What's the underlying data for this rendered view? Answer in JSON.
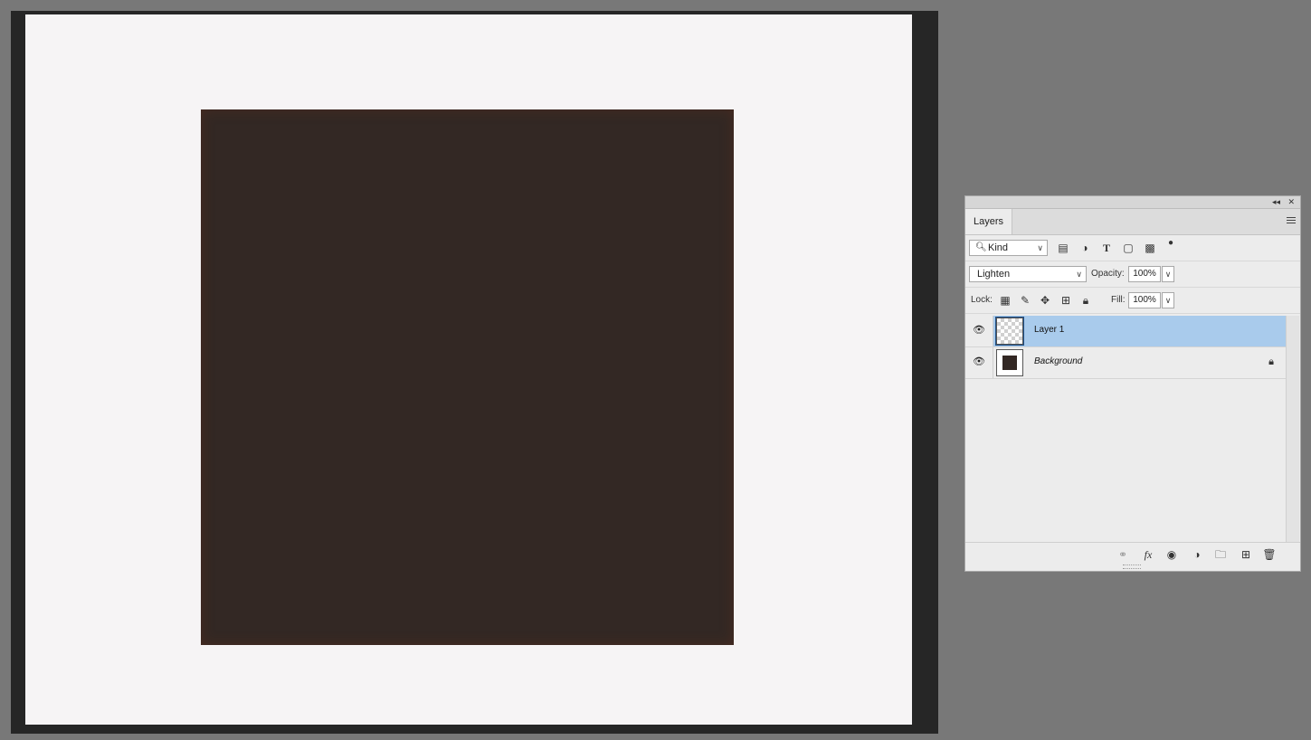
{
  "document": {
    "canvas_color": "#f6f4f5",
    "square_color": "#332824"
  },
  "layers_panel": {
    "tab_label": "Layers",
    "collapse_icon": "double-chevron-left-icon",
    "close_icon": "close-icon",
    "filter": {
      "kind_label": "Kind",
      "icons": [
        "pixel-layer-filter-icon",
        "adjustment-layer-filter-icon",
        "type-layer-filter-icon",
        "shape-layer-filter-icon",
        "smart-object-filter-icon",
        "filter-toggle-icon"
      ]
    },
    "blend_mode": "Lighten",
    "opacity_label": "Opacity:",
    "opacity_value": "100%",
    "lock_label": "Lock:",
    "fill_label": "Fill:",
    "fill_value": "100%",
    "layers": [
      {
        "name": "Layer 1",
        "visible": true,
        "selected": true,
        "locked": false
      },
      {
        "name": "Background",
        "visible": true,
        "selected": false,
        "locked": true
      }
    ],
    "bottom_icons": [
      "link-layers-icon",
      "fx-icon",
      "add-mask-icon",
      "adjustment-layer-icon",
      "new-group-icon",
      "new-layer-icon",
      "delete-layer-icon"
    ],
    "fx_label": "fx"
  }
}
